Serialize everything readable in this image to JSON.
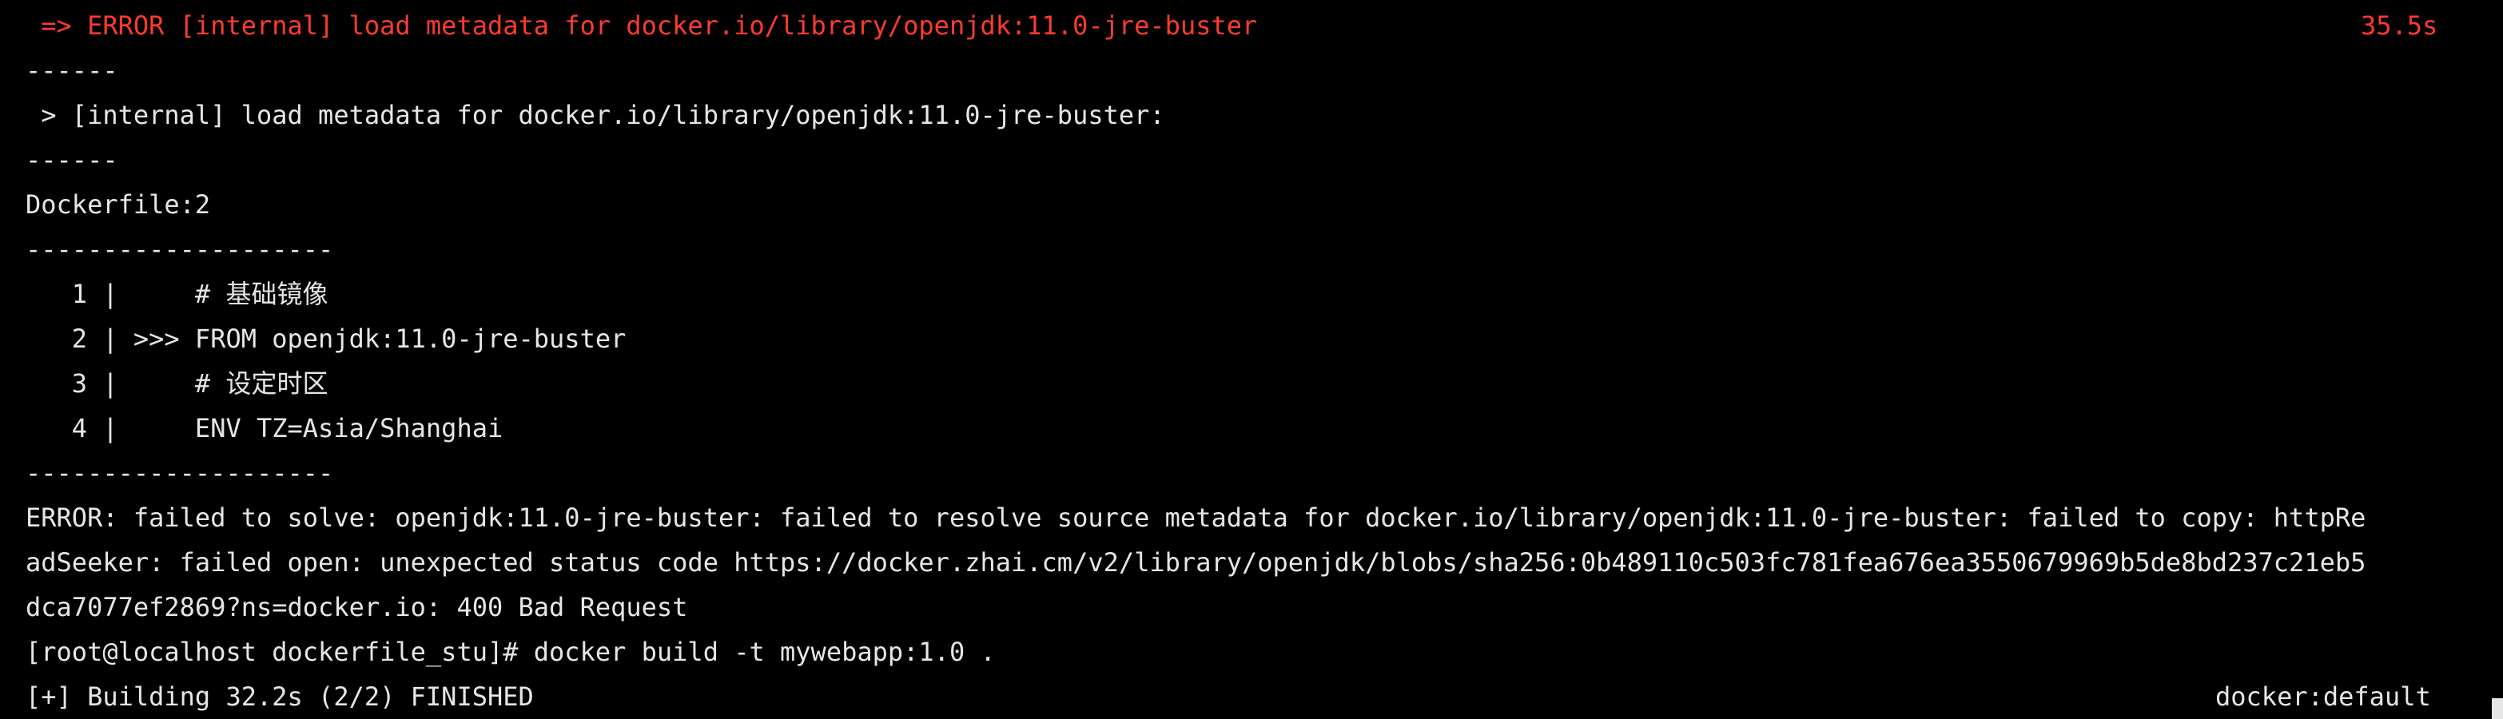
{
  "terminal": {
    "error_header": " => ERROR [internal] load metadata for docker.io/library/openjdk:11.0-jre-buster",
    "error_header_time": "35.5s",
    "sep_short_1": "------",
    "internal_line": " > [internal] load metadata for docker.io/library/openjdk:11.0-jre-buster:",
    "sep_short_2": "------",
    "dockerfile_ref": "Dockerfile:2",
    "sep_long_1": "--------------------",
    "code_lines": [
      "   1 |     # 基础镜像",
      "   2 | >>> FROM openjdk:11.0-jre-buster",
      "   3 |     # 设定时区",
      "   4 |     ENV TZ=Asia/Shanghai"
    ],
    "sep_long_2": "--------------------",
    "error_lines": [
      "ERROR: failed to solve: openjdk:11.0-jre-buster: failed to resolve source metadata for docker.io/library/openjdk:11.0-jre-buster: failed to copy: httpRe",
      "adSeeker: failed open: unexpected status code https://docker.zhai.cm/v2/library/openjdk/blobs/sha256:0b489110c503fc781fea676ea3550679969b5de8bd237c21eb5",
      "dca7077ef2869?ns=docker.io: 400 Bad Request"
    ],
    "prompt": "[root@localhost dockerfile_stu]# docker build -t mywebapp:1.0 .",
    "building_status": "[+] Building 32.2s (2/2) FINISHED",
    "builder_name": "docker:default"
  },
  "colors": {
    "background": "#000000",
    "text": "#e6e6e6",
    "error": "#ff3b30"
  }
}
